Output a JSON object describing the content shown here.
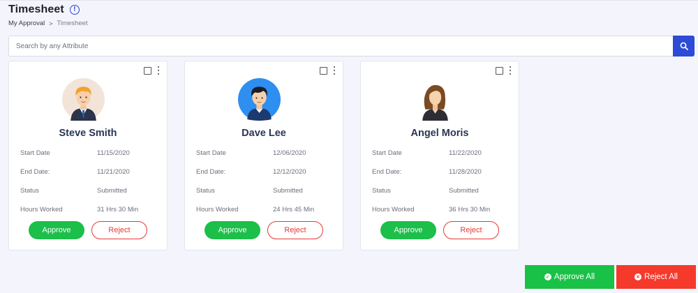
{
  "page": {
    "title": "Timesheet",
    "info_icon": "info-icon",
    "info_glyph": "!"
  },
  "breadcrumb": {
    "items": [
      "My Approval",
      "Timesheet"
    ],
    "separator": ">"
  },
  "search": {
    "placeholder": "Search by any Attribute",
    "value": "",
    "icon": "search-icon"
  },
  "cards": [
    {
      "name": "Steve Smith",
      "avatar": "man-blond-avatar",
      "fields": [
        {
          "label": "Start Date",
          "value": "11/15/2020"
        },
        {
          "label": "End Date:",
          "value": "11/21/2020"
        },
        {
          "label": "Status",
          "value": "Submitted"
        },
        {
          "label": "Hours Worked",
          "value": "31 Hrs 30 Min"
        }
      ],
      "approve_label": "Approve",
      "reject_label": "Reject"
    },
    {
      "name": "Dave Lee",
      "avatar": "man-dark-hair-avatar",
      "fields": [
        {
          "label": "Start Date",
          "value": "12/06/2020"
        },
        {
          "label": "End Date:",
          "value": "12/12/2020"
        },
        {
          "label": "Status",
          "value": "Submitted"
        },
        {
          "label": "Hours Worked",
          "value": "24 Hrs 45 Min"
        }
      ],
      "approve_label": "Approve",
      "reject_label": "Reject"
    },
    {
      "name": "Angel Moris",
      "avatar": "woman-avatar",
      "fields": [
        {
          "label": "Start Date",
          "value": "11/22/2020"
        },
        {
          "label": "End Date:",
          "value": "11/28/2020"
        },
        {
          "label": "Status",
          "value": "Submitted"
        },
        {
          "label": "Hours Worked",
          "value": "36 Hrs 30 Min"
        }
      ],
      "approve_label": "Approve",
      "reject_label": "Reject"
    }
  ],
  "footer": {
    "approve_all_label": "Approve All",
    "reject_all_label": "Reject All",
    "approve_icon": "check-circle-icon",
    "reject_icon": "close-circle-icon",
    "approve_glyph": "✓",
    "reject_glyph": "✕"
  },
  "colors": {
    "primary": "#2c4bd6",
    "approve": "#1bbf4a",
    "reject": "#e23a34",
    "name_text": "#2a3655"
  }
}
